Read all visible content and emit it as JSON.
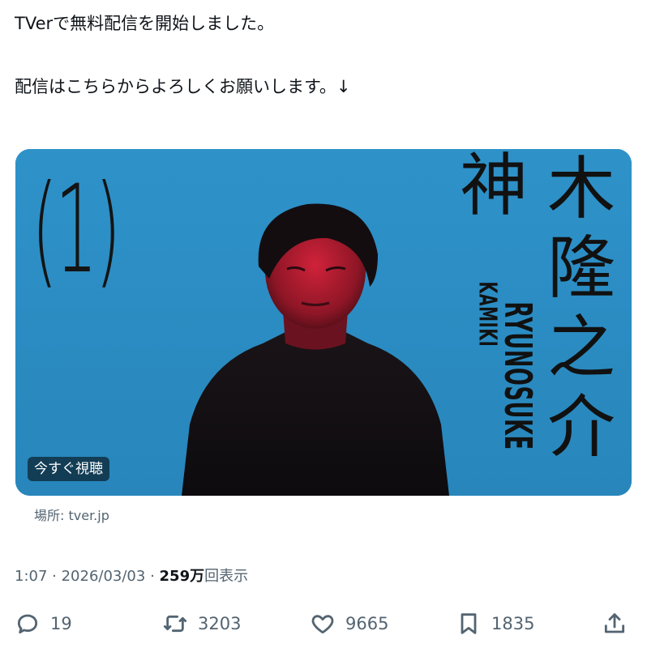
{
  "tweet": {
    "line1": "TVerで無料配信を開始しました。",
    "line2": "配信はこちらからよろしくお願いします。↓"
  },
  "card": {
    "episode": "(1)",
    "name_kanji_1": "神",
    "name_kanji_2": [
      "木",
      "隆",
      "之",
      "介"
    ],
    "name_roman_1": "KAMIKI",
    "name_roman_2": "RYUNOSUKE",
    "watch_label": "今すぐ視聴",
    "source": "場所: tver.jp",
    "bg_color": "#2b8dc3"
  },
  "meta": {
    "time": "1:07",
    "sep1": " · ",
    "date": "2026/03/03",
    "sep2": " · ",
    "views_bold": "259万",
    "views_suffix": "回表示"
  },
  "actions": {
    "reply": {
      "icon": "reply-icon",
      "count": "19"
    },
    "retweet": {
      "icon": "retweet-icon",
      "count": "3203"
    },
    "like": {
      "icon": "heart-icon",
      "count": "9665"
    },
    "bookmark": {
      "icon": "bookmark-icon",
      "count": "1835"
    },
    "share": {
      "icon": "share-icon"
    }
  }
}
